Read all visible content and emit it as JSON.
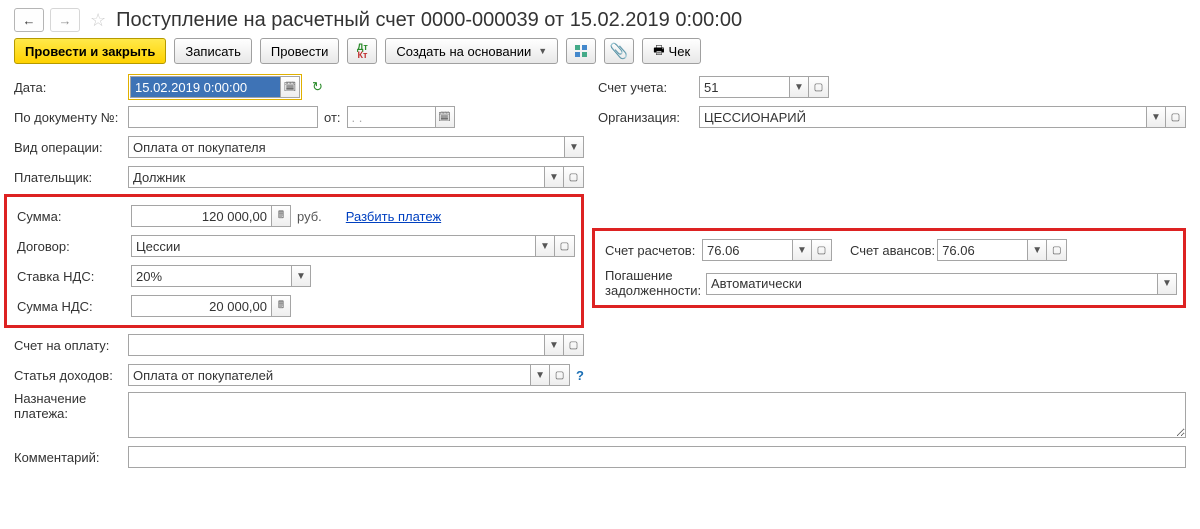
{
  "title": "Поступление на расчетный счет 0000-000039 от 15.02.2019 0:00:00",
  "toolbar": {
    "post_close": "Провести и закрыть",
    "save": "Записать",
    "post": "Провести",
    "create_based": "Создать на основании",
    "check": "Чек"
  },
  "labels": {
    "date": "Дата:",
    "doc_no": "По документу №:",
    "from": "от:",
    "operation_type": "Вид операции:",
    "payer": "Плательщик:",
    "sum": "Сумма:",
    "currency": "руб.",
    "split": "Разбить платеж",
    "contract": "Договор:",
    "vat_rate": "Ставка НДС:",
    "vat_sum": "Сумма НДС:",
    "invoice": "Счет на оплату:",
    "income_article": "Статья доходов:",
    "purpose": "Назначение платежа:",
    "comment": "Комментарий:",
    "account_ledger": "Счет учета:",
    "organization": "Организация:",
    "account_settlements": "Счет расчетов:",
    "account_advances": "Счет авансов:",
    "debt_repayment": "Погашение задолженности:"
  },
  "values": {
    "date": "15.02.2019  0:00:00",
    "doc_no": "",
    "doc_from": ". .",
    "operation_type": "Оплата от покупателя",
    "payer": "Должник",
    "sum": "120 000,00",
    "contract": "Цессии",
    "vat_rate": "20%",
    "vat_sum": "20 000,00",
    "invoice": "",
    "income_article": "Оплата от покупателей",
    "account_ledger": "51",
    "organization": "ЦЕССИОНАРИЙ",
    "account_settlements": "76.06",
    "account_advances": "76.06",
    "debt_repayment": "Автоматически"
  }
}
